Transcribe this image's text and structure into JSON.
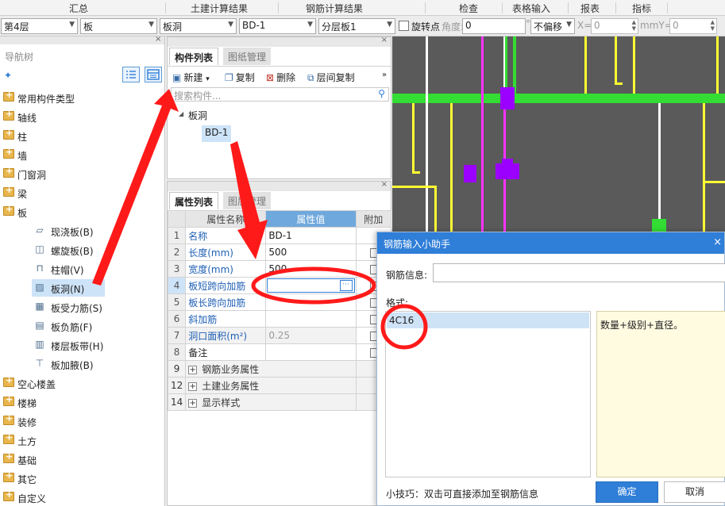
{
  "menu": {
    "items": [
      "汇总",
      "土建计算结果",
      "钢筋计算结果",
      "检查",
      "表格输入",
      "报表",
      "指标"
    ]
  },
  "toolbar": {
    "floor": "第4层",
    "category": "板",
    "type": "板洞",
    "component": "BD-1",
    "layer": "分层板1",
    "rotate_label": "旋转点",
    "angle_label": "角度:",
    "angle_value": "0",
    "angle_unit": "°",
    "offset": "不偏移",
    "x_label": "X=",
    "x_value": "0",
    "y_label": "mmY=",
    "y_value": "0"
  },
  "nav": {
    "title": "导航树",
    "items_top": [
      "常用构件类型",
      "轴线",
      "柱",
      "墙",
      "门窗洞",
      "梁",
      "板"
    ],
    "sub_items": [
      {
        "label": "现浇板(B)",
        "icon": "slab-icon"
      },
      {
        "label": "螺旋板(B)",
        "icon": "spiral-slab-icon"
      },
      {
        "label": "柱帽(V)",
        "icon": "column-cap-icon"
      },
      {
        "label": "板洞(N)",
        "icon": "slab-hole-icon"
      },
      {
        "label": "板受力筋(S)",
        "icon": "slab-rebar-icon"
      },
      {
        "label": "板负筋(F)",
        "icon": "negative-rebar-icon"
      },
      {
        "label": "楼层板带(H)",
        "icon": "slab-strip-icon"
      },
      {
        "label": "板加腋(B)",
        "icon": "slab-haunch-icon"
      }
    ],
    "items_bottom": [
      "空心楼盖",
      "楼梯",
      "装修",
      "土方",
      "基础",
      "其它",
      "自定义"
    ]
  },
  "component_panel": {
    "tabs": [
      "构件列表",
      "图纸管理"
    ],
    "buttons": [
      "新建",
      "复制",
      "删除",
      "层间复制"
    ],
    "new_arrow": "▾",
    "more": "»",
    "search_placeholder": "搜索构件...",
    "tree_parent": "板洞",
    "tree_child": "BD-1"
  },
  "properties": {
    "tabs": [
      "属性列表",
      "图层管理"
    ],
    "headers": [
      "属性名称",
      "属性值",
      "附加"
    ],
    "rows": [
      {
        "no": "1",
        "name": "名称",
        "value": "BD-1",
        "check": false
      },
      {
        "no": "2",
        "name": "长度(mm)",
        "value": "500",
        "check": true
      },
      {
        "no": "3",
        "name": "宽度(mm)",
        "value": "500",
        "check": true
      },
      {
        "no": "4",
        "name": "板短跨向加筋",
        "value": "",
        "check": true
      },
      {
        "no": "5",
        "name": "板长跨向加筋",
        "value": "",
        "check": true
      },
      {
        "no": "6",
        "name": "斜加筋",
        "value": "",
        "check": true
      },
      {
        "no": "7",
        "name": "洞口面积(m²)",
        "value": "0.25",
        "check": true
      },
      {
        "no": "8",
        "name": "备注",
        "value": "",
        "check": true
      }
    ],
    "groups": [
      {
        "no": "9",
        "name": "钢筋业务属性"
      },
      {
        "no": "12",
        "name": "土建业务属性"
      },
      {
        "no": "14",
        "name": "显示样式"
      }
    ],
    "ellipsis": "···"
  },
  "dialog": {
    "title": "钢筋输入小助手",
    "close": "×",
    "rebar_label": "钢筋信息:",
    "format_label": "格式:",
    "format_item": "4C16",
    "format_desc": "数量+级别+直径。",
    "tip": "小技巧：双击可直接添加至钢筋信息",
    "ok": "确定",
    "cancel": "取消"
  },
  "colors": {
    "annotation": "#ff1a1a",
    "accent": "#2f7ed8",
    "canvas_bg": "#5a5a5a",
    "line_green": "#33dd33",
    "line_yellow": "#ffff33",
    "line_magenta": "#ff33ff",
    "line_white": "#ffffff",
    "block_purple": "#9b00ff"
  }
}
